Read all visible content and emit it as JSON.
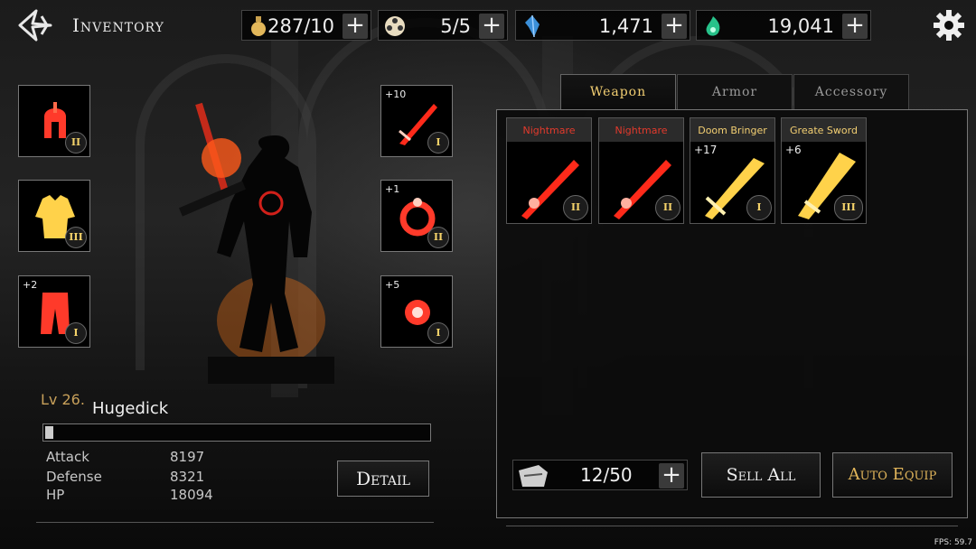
{
  "header": {
    "title": "Inventory",
    "resources": [
      {
        "icon": "potion-bottle-icon",
        "value": "287/10"
      },
      {
        "icon": "film-reel-icon",
        "value": "5/5"
      },
      {
        "icon": "blue-crystal-icon",
        "value": "1,471"
      },
      {
        "icon": "green-soul-icon",
        "value": "19,041"
      }
    ],
    "plus": "+"
  },
  "equipment": {
    "helmet": {
      "tier": "II",
      "plus": ""
    },
    "chest": {
      "tier": "III",
      "plus": ""
    },
    "pants": {
      "tier": "I",
      "plus": "+2"
    },
    "weapon": {
      "tier": "I",
      "plus": "+10"
    },
    "ring": {
      "tier": "II",
      "plus": "+1"
    },
    "amulet": {
      "tier": "I",
      "plus": "+5"
    }
  },
  "character": {
    "level": "Lv 26.",
    "name": "Hugedick",
    "xp_fraction": 0.02,
    "stats": [
      {
        "label": "Attack",
        "value": "8197"
      },
      {
        "label": "Defense",
        "value": "8321"
      },
      {
        "label": "HP",
        "value": "18094"
      }
    ],
    "detail_label": "Detail"
  },
  "tabs": [
    "Weapon",
    "Armor",
    "Accessory"
  ],
  "items": [
    {
      "name": "Nightmare",
      "plus": "",
      "tier": "II",
      "rarity": "red"
    },
    {
      "name": "Nightmare",
      "plus": "",
      "tier": "II",
      "rarity": "red"
    },
    {
      "name": "Doom Bringer",
      "plus": "+17",
      "tier": "I",
      "rarity": "gold"
    },
    {
      "name": "Greate Sword",
      "plus": "+6",
      "tier": "III",
      "rarity": "gold"
    }
  ],
  "bag": {
    "value": "12/50"
  },
  "buttons": {
    "sell_all": "Sell All",
    "auto_equip": "Auto Equip"
  },
  "fps": "FPS: 59.7",
  "colors": {
    "red": "#e33a2c",
    "gold": "#f3cf72"
  }
}
